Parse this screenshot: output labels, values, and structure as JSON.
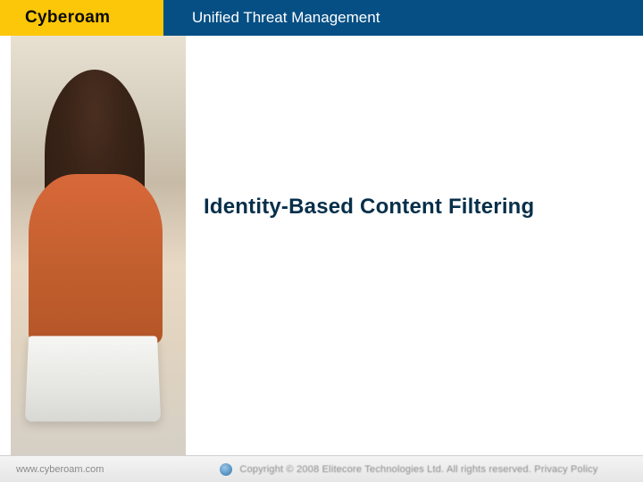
{
  "header": {
    "brand": "Cyberoam",
    "title": "Unified Threat Management"
  },
  "main": {
    "heading": "Identity-Based Content Filtering"
  },
  "footer": {
    "website": "www.cyberoam.com",
    "copyright": "Copyright © 2008 Elitecore Technologies Ltd. All rights reserved. Privacy Policy"
  },
  "colors": {
    "brand_bg": "#fcc708",
    "header_bg": "#054f84",
    "heading_fg": "#072f4a"
  }
}
